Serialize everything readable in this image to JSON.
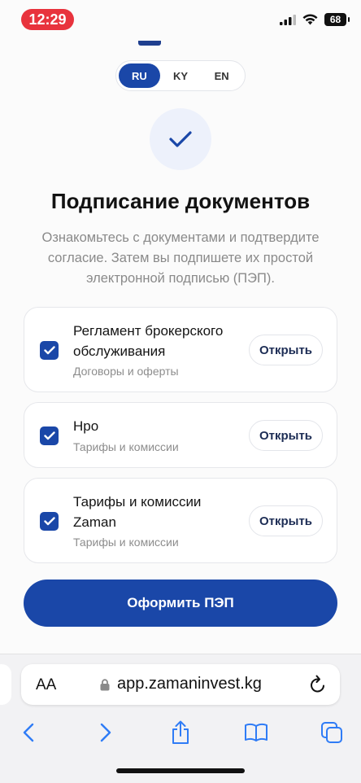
{
  "status_bar": {
    "time": "12:29",
    "battery": "68"
  },
  "language": {
    "options": [
      "RU",
      "KY",
      "EN"
    ],
    "selected": "RU"
  },
  "header": {
    "title": "Подписание документов",
    "subtitle": "Ознакомьтесь с документами и подтвердите согласие. Затем вы подпишете их простой электронной подписью (ПЭП)."
  },
  "documents": [
    {
      "title": "Регламент брокерского обслуживания",
      "category": "Договоры и оферты",
      "checked": true,
      "open_label": "Открыть"
    },
    {
      "title": "Нро",
      "category": "Тарифы и комиссии",
      "checked": true,
      "open_label": "Открыть"
    },
    {
      "title": "Тарифы и комиссии Zaman",
      "category": "Тарифы и комиссии",
      "checked": true,
      "open_label": "Открыть"
    }
  ],
  "primary_action": {
    "label": "Оформить ПЭП"
  },
  "browser": {
    "aa_label": "AA",
    "url": "app.zamaninvest.kg"
  },
  "colors": {
    "accent": "#1a47a8",
    "time_pill": "#e8333d",
    "ios_blue": "#2f7cf6"
  }
}
